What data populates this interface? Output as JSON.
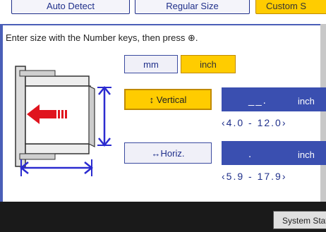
{
  "tabs": [
    {
      "label": "Auto Detect"
    },
    {
      "label": "Regular Size"
    },
    {
      "label": "Custom S"
    }
  ],
  "instruction": "Enter size with the Number keys, then press ⊕.",
  "units": {
    "mm_label": "mm",
    "inch_label": "inch",
    "selected": "inch"
  },
  "vertical": {
    "label": "↕ Vertical",
    "value": "__.",
    "unit": "inch",
    "range": "‹4.0 - 12.0›"
  },
  "horizontal": {
    "label": "↔Horiz.",
    "value": ".",
    "unit": "inch",
    "range": "‹5.9 - 17.9›"
  },
  "footer": {
    "system_status_label": "System Statu"
  },
  "colors": {
    "accent_yellow": "#ffcc00",
    "field_blue": "#3a4fb0",
    "arrow_red": "#e0141e",
    "diagram_blue": "#2b2bd0"
  }
}
